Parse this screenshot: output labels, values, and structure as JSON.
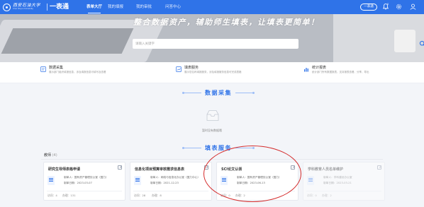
{
  "header": {
    "logo_cn": "西安石油大学",
    "logo_en": "Xi'an Shiyou University",
    "app_name": "一表通",
    "nav": [
      "表单大厅",
      "我的填报",
      "我的审批",
      "问答中心"
    ],
    "active_nav": 0,
    "pill_button": "一表通",
    "badge_count": "0"
  },
  "banner": {
    "slogan": "整合数据资产，辅助师生填表，让填表更简单！",
    "search_placeholder": "请输入关键字"
  },
  "features": [
    {
      "title": "数据采集",
      "desc": "展示部门组织填报信息，涉及填报信息可填写及查看"
    },
    {
      "title": "填表服务",
      "desc": "展示您名称填报服务，涉及填报服务信息可完成表格"
    },
    {
      "title": "统计报表",
      "desc": "统计部门所有数据报表，支持报表查看、分享、导出"
    }
  ],
  "sections": {
    "data_collect": "数据采集",
    "fill_service": "填表服务"
  },
  "empty_state": "暂时没有数据哦",
  "group": {
    "label": "教师",
    "count": "(4)"
  },
  "cards": [
    {
      "title": "研究生导师表格申请",
      "maker_label": "制单人：",
      "maker": "国有资产管理处公室（国力）",
      "date_label": "制单日期：",
      "date": "2023-03-07",
      "visits_label": "访问：",
      "visits": "4",
      "done_label": "办理：",
      "done": "131"
    },
    {
      "title": "信息化项目预算审核需求信息表",
      "maker_label": "制单人：",
      "maker": "网络与信息化办公室（国力中心）",
      "date_label": "制单日期：",
      "date": "2021-12-23",
      "visits_label": "访问：",
      "visits": "28",
      "done_label": "办理：",
      "done": "8"
    },
    {
      "title": "SCI论文认领",
      "maker_label": "制单人：",
      "maker": "国有资产管理处公室（国力）",
      "date_label": "制单日期：",
      "date": "2023-06-13",
      "visits_label": "访问：",
      "visits": "0",
      "done_label": "办理：",
      "done": "2"
    },
    {
      "title": "学科教育人员名单维护",
      "maker_label": "制单人：",
      "maker": "学科建设办公室",
      "date_label": "制单日期：",
      "date": "2023-03-21",
      "visits_label": "访问：",
      "visits": "0",
      "done_label": "办理：",
      "done": "2"
    }
  ],
  "colors": {
    "primary": "#2f73e8",
    "highlight": "#d42a2a"
  }
}
